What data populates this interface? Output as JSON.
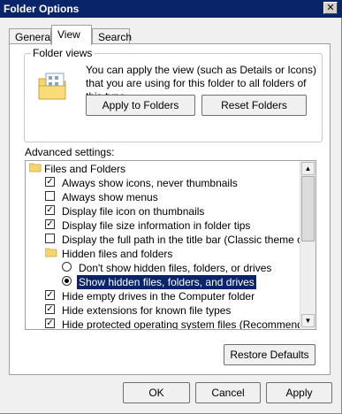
{
  "window": {
    "title": "Folder Options",
    "close_label": "✕"
  },
  "tabs": [
    {
      "label": "General"
    },
    {
      "label": "View"
    },
    {
      "label": "Search"
    }
  ],
  "folder_views": {
    "title": "Folder views",
    "description": "You can apply the view (such as Details or Icons) that you are using for this folder to all folders of this type.",
    "apply_button": "Apply to Folders",
    "reset_button": "Reset Folders"
  },
  "advanced": {
    "label": "Advanced settings:",
    "items": [
      {
        "type": "folder",
        "label": "Files and Folders"
      },
      {
        "type": "checkbox",
        "checked": true,
        "label": "Always show icons, never thumbnails"
      },
      {
        "type": "checkbox",
        "checked": false,
        "label": "Always show menus"
      },
      {
        "type": "checkbox",
        "checked": true,
        "label": "Display file icon on thumbnails"
      },
      {
        "type": "checkbox",
        "checked": true,
        "label": "Display file size information in folder tips"
      },
      {
        "type": "checkbox",
        "checked": false,
        "label": "Display the full path in the title bar (Classic theme only)"
      },
      {
        "type": "folder",
        "label": "Hidden files and folders"
      },
      {
        "type": "radio",
        "checked": false,
        "label": "Don't show hidden files, folders, or drives"
      },
      {
        "type": "radio",
        "checked": true,
        "label": "Show hidden files, folders, and drives"
      },
      {
        "type": "checkbox",
        "checked": true,
        "label": "Hide empty drives in the Computer folder"
      },
      {
        "type": "checkbox",
        "checked": true,
        "label": "Hide extensions for known file types"
      },
      {
        "type": "checkbox",
        "checked": true,
        "label": "Hide protected operating system files (Recommended)"
      }
    ]
  },
  "restore_button": "Restore Defaults",
  "footer": {
    "ok": "OK",
    "cancel": "Cancel",
    "apply": "Apply"
  },
  "colors": {
    "title_bar": "#0a246a",
    "selection": "#0a246a"
  }
}
